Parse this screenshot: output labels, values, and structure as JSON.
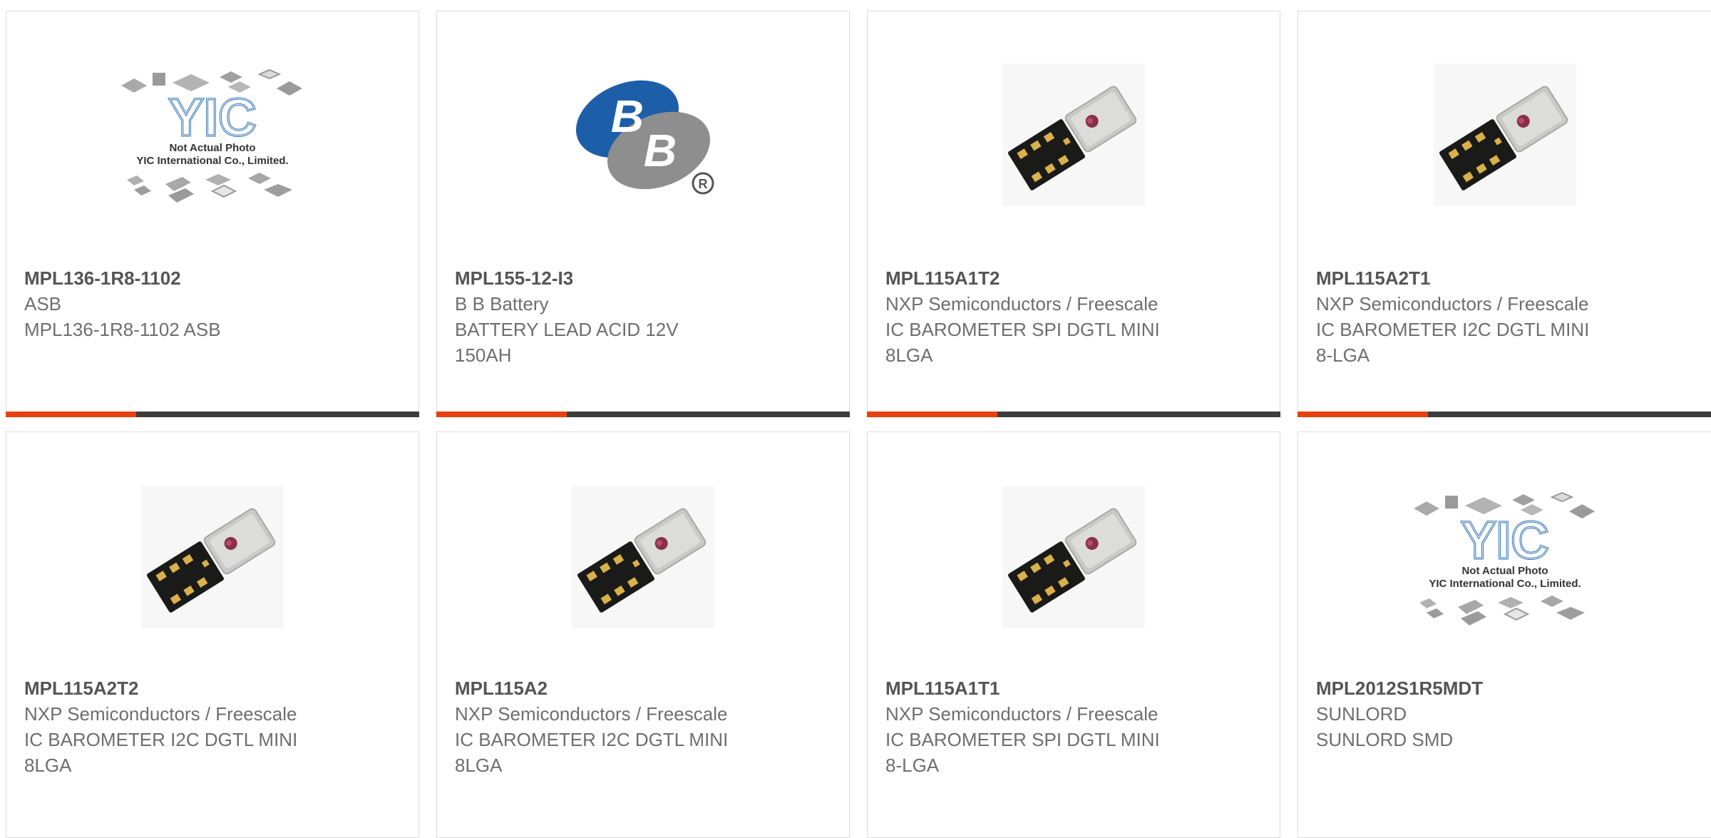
{
  "colors": {
    "accent": "#e8400f",
    "bar": "#3c3c3c",
    "text": "#6e6e6e",
    "border": "#dcdcdc"
  },
  "placeholder": {
    "line1": "Not Actual Photo",
    "line2": "YIC International Co., Limited."
  },
  "products": [
    {
      "part_number": "MPL136-1R8-1102",
      "manufacturer": "ASB",
      "desc1": "MPL136-1R8-1102 ASB",
      "desc2": "",
      "image": "placeholder-yic-icon"
    },
    {
      "part_number": "MPL155-12-I3",
      "manufacturer": "B B Battery",
      "desc1": "BATTERY LEAD ACID 12V",
      "desc2": "150AH",
      "image": "bb-battery-logo-icon"
    },
    {
      "part_number": "MPL115A1T2",
      "manufacturer": "NXP Semiconductors / Freescale",
      "desc1": "IC BAROMETER SPI DGTL MINI",
      "desc2": "8LGA",
      "image": "barometer-chip-icon"
    },
    {
      "part_number": "MPL115A2T1",
      "manufacturer": "NXP Semiconductors / Freescale",
      "desc1": "IC BAROMETER I2C DGTL MINI",
      "desc2": "8-LGA",
      "image": "barometer-chip-icon"
    },
    {
      "part_number": "MPL115A2T2",
      "manufacturer": "NXP Semiconductors / Freescale",
      "desc1": "IC BAROMETER I2C DGTL MINI",
      "desc2": "8LGA",
      "image": "barometer-chip-icon"
    },
    {
      "part_number": "MPL115A2",
      "manufacturer": "NXP Semiconductors / Freescale",
      "desc1": "IC BAROMETER I2C DGTL MINI",
      "desc2": "8LGA",
      "image": "barometer-chip-icon"
    },
    {
      "part_number": "MPL115A1T1",
      "manufacturer": "NXP Semiconductors / Freescale",
      "desc1": "IC BAROMETER SPI DGTL MINI",
      "desc2": "8-LGA",
      "image": "barometer-chip-icon"
    },
    {
      "part_number": "MPL2012S1R5MDT",
      "manufacturer": "SUNLORD",
      "desc1": "SUNLORD SMD",
      "desc2": "",
      "image": "placeholder-yic-icon"
    }
  ]
}
